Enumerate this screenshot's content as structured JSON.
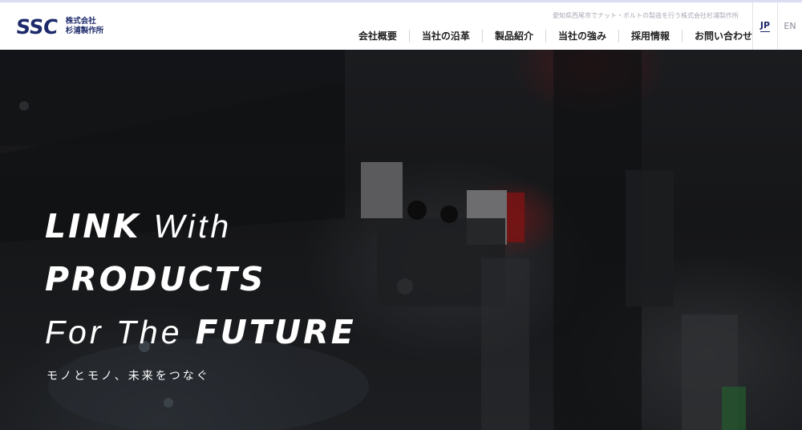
{
  "header": {
    "logo_mark": "SSC",
    "logo_line1": "株式会社",
    "logo_line2": "杉浦製作所",
    "tagline": "愛知県西尾市でナット・ボルトの製造を行う株式会社杉浦製作所",
    "nav": [
      {
        "label": "会社概要"
      },
      {
        "label": "当社の沿革"
      },
      {
        "label": "製品紹介"
      },
      {
        "label": "当社の強み"
      },
      {
        "label": "採用情報"
      },
      {
        "label": "お問い合わせ"
      }
    ],
    "lang": {
      "jp": "JP",
      "en": "EN",
      "active": "JP"
    }
  },
  "hero": {
    "line1_bold": "LINK",
    "line1_light": "With",
    "line2_bold": "PRODUCTS",
    "line3_light": "For The",
    "line3_bold": "FUTURE",
    "subcopy": "モノとモノ、未来をつなぐ"
  },
  "colors": {
    "brand": "#1d2a6b",
    "nav_text": "#222222",
    "hero_text": "#ffffff",
    "topline": "#dcdcf2"
  }
}
